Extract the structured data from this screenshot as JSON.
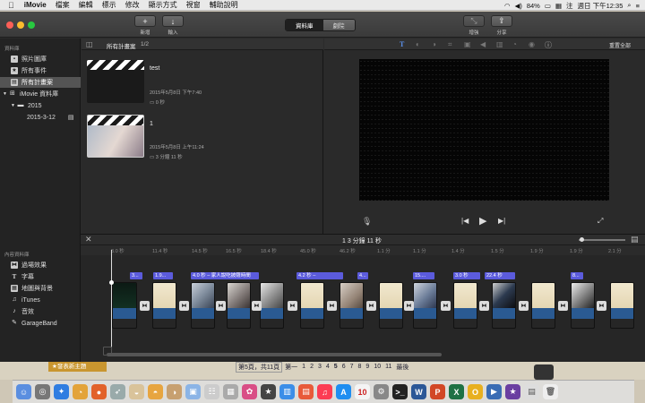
{
  "menubar": {
    "app": "iMovie",
    "items": [
      "檔案",
      "編輯",
      "標示",
      "修改",
      "顯示方式",
      "視窗",
      "輔助說明"
    ],
    "status": {
      "battery": "84%",
      "input_method": "注",
      "datetime": "週日 下午12:35"
    }
  },
  "toolbar": {
    "new_label": "新增",
    "import_label": "輸入",
    "tab_library": "資料庫",
    "tab_theater": "劇院",
    "enhance_label": "增強",
    "share_label": "分享"
  },
  "sidebar": {
    "section_libraries": "資料庫",
    "items": [
      {
        "label": "照片圖庫",
        "icon": "photos-icon"
      },
      {
        "label": "所有事件",
        "icon": "events-icon"
      },
      {
        "label": "所有計畫案",
        "icon": "projects-icon",
        "selected": true
      },
      {
        "label": "iMovie 資料庫",
        "icon": "library-grid-icon"
      },
      {
        "label": "2015",
        "icon": "folder-icon"
      },
      {
        "label": "2015-3-12",
        "icon": "clapper-icon"
      }
    ],
    "section_content": "內容資料庫",
    "content_items": [
      {
        "label": "過場效果",
        "icon": "transitions-icon"
      },
      {
        "label": "字幕",
        "icon": "titles-icon"
      },
      {
        "label": "地圖與背景",
        "icon": "maps-icon"
      },
      {
        "label": "iTunes",
        "icon": "music-note-icon"
      },
      {
        "label": "音效",
        "icon": "sound-effects-icon"
      },
      {
        "label": "GarageBand",
        "icon": "guitar-icon"
      }
    ]
  },
  "projects": {
    "header": "所有計畫案",
    "count": "1/2",
    "list": [
      {
        "title": "test",
        "date": "2015年5月8日 下午7:40",
        "duration": "0 秒"
      },
      {
        "title": "1",
        "date": "2015年5月8日 上午11:24",
        "duration": "3 分鐘 11 秒"
      }
    ]
  },
  "viewer": {
    "reset_all": "重置全部"
  },
  "timeline": {
    "duration": "1 3 分鐘 11 秒",
    "ruler": [
      "3.0 秒",
      "11.4 秒",
      "14.5 秒",
      "16.5 秒",
      "18.4 秒",
      "45.0 秒",
      "46.2 秒",
      "1.1 分",
      "1.1 分",
      "1.4 分",
      "1.5 分",
      "1.9 分",
      "1.9 分",
      "2.1 分"
    ],
    "titles": [
      "3...",
      "1.9...",
      "4.0 秒 – 家人說吃披薩時間",
      "4.2 秒 –",
      "4...",
      "15....",
      "3.0 秒",
      "22.4 秒",
      "8..."
    ]
  },
  "backdrop": {
    "topic_button": "★發表新主題",
    "pager": "第5頁，共11頁",
    "first": "第一",
    "pages": [
      "1",
      "2",
      "3",
      "4",
      "5",
      "6",
      "7",
      "8",
      "9",
      "10",
      "11"
    ],
    "last": "最後"
  }
}
